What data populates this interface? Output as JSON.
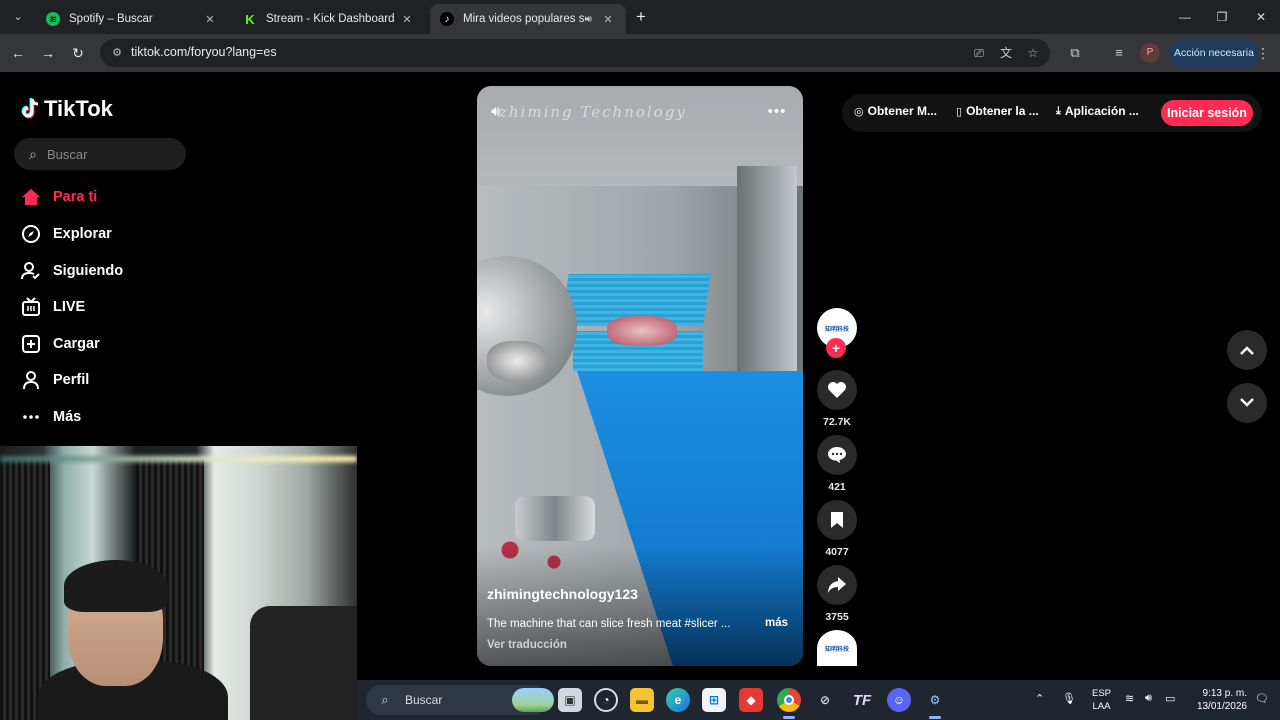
{
  "browser": {
    "tabs": [
      {
        "title": "Spotify – Buscar",
        "favicon": "spotify-icon",
        "color": "#1db954"
      },
      {
        "title": "Stream - Kick Dashboard",
        "favicon": "kick-icon",
        "color": "#53fc18"
      },
      {
        "title": "Mira videos populares sele",
        "favicon": "tiktok-icon",
        "active": true
      }
    ],
    "url": "tiktok.com/foryou?lang=es",
    "profile_initial": "P",
    "action_button": "Acción necesaria"
  },
  "tiktok": {
    "logo_text": "TikTok",
    "search_placeholder": "Buscar",
    "nav": [
      {
        "label": "Para ti",
        "icon": "home-icon",
        "active": true
      },
      {
        "label": "Explorar",
        "icon": "compass-icon"
      },
      {
        "label": "Siguiendo",
        "icon": "following-icon"
      },
      {
        "label": "LIVE",
        "icon": "live-icon"
      },
      {
        "label": "Cargar",
        "icon": "upload-icon"
      },
      {
        "label": "Perfil",
        "icon": "profile-icon"
      },
      {
        "label": "Más",
        "icon": "more-icon"
      }
    ],
    "top_actions": [
      {
        "label": "Obtener M...",
        "icon": "coin-icon"
      },
      {
        "label": "Obtener la ...",
        "icon": "phone-icon"
      },
      {
        "label": "Aplicación ...",
        "icon": "download-icon"
      }
    ],
    "login_button": "Iniciar sesión",
    "accent": "#fe2c55",
    "video": {
      "watermark": "zhiming Technology",
      "username": "zhimingtechnology123",
      "description": "The machine that can slice fresh meat #slicer ...",
      "more_label": "más",
      "translate_label": "Ver traducción",
      "avatar_text": "知明科技"
    },
    "stats": {
      "likes": "72.7K",
      "comments": "421",
      "saves": "4077",
      "shares": "3755"
    }
  },
  "taskbar": {
    "search_label": "Buscar",
    "language": {
      "line1": "ESP",
      "line2": "LAA"
    },
    "time": "9:13 p. m.",
    "date": "13/01/2026"
  }
}
